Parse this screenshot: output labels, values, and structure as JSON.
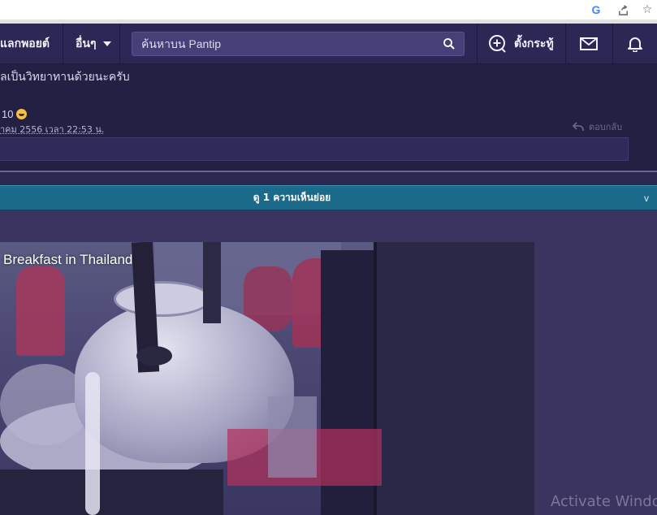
{
  "browser": {
    "icons": [
      "google-icon",
      "share-icon",
      "star-icon"
    ],
    "google_label": "G",
    "star_label": "☆"
  },
  "navbar": {
    "points_label": "แลกพอยต์",
    "other_label": "อื่นๆ",
    "search_placeholder": "ค้นหาบน Pantip",
    "create_label": "ตั้งกระทู้"
  },
  "comment": {
    "text": "ลเป็นวิทยาทานด้วยนะครับ",
    "member_id": "10",
    "date": "าคม 2556 เวลา 22:53 น.",
    "reply_label": "ตอบกลับ"
  },
  "subcomments": {
    "label": "ดู 1 ความเห็นย่อย",
    "chevron": "v"
  },
  "video": {
    "title": "Breakfast in Thailand"
  },
  "watermark": "Activate Windo",
  "colors": {
    "navbar_bg": "#2c2754",
    "page_bg": "#3b3461",
    "subcomment_bar": "#1c6a8a"
  }
}
